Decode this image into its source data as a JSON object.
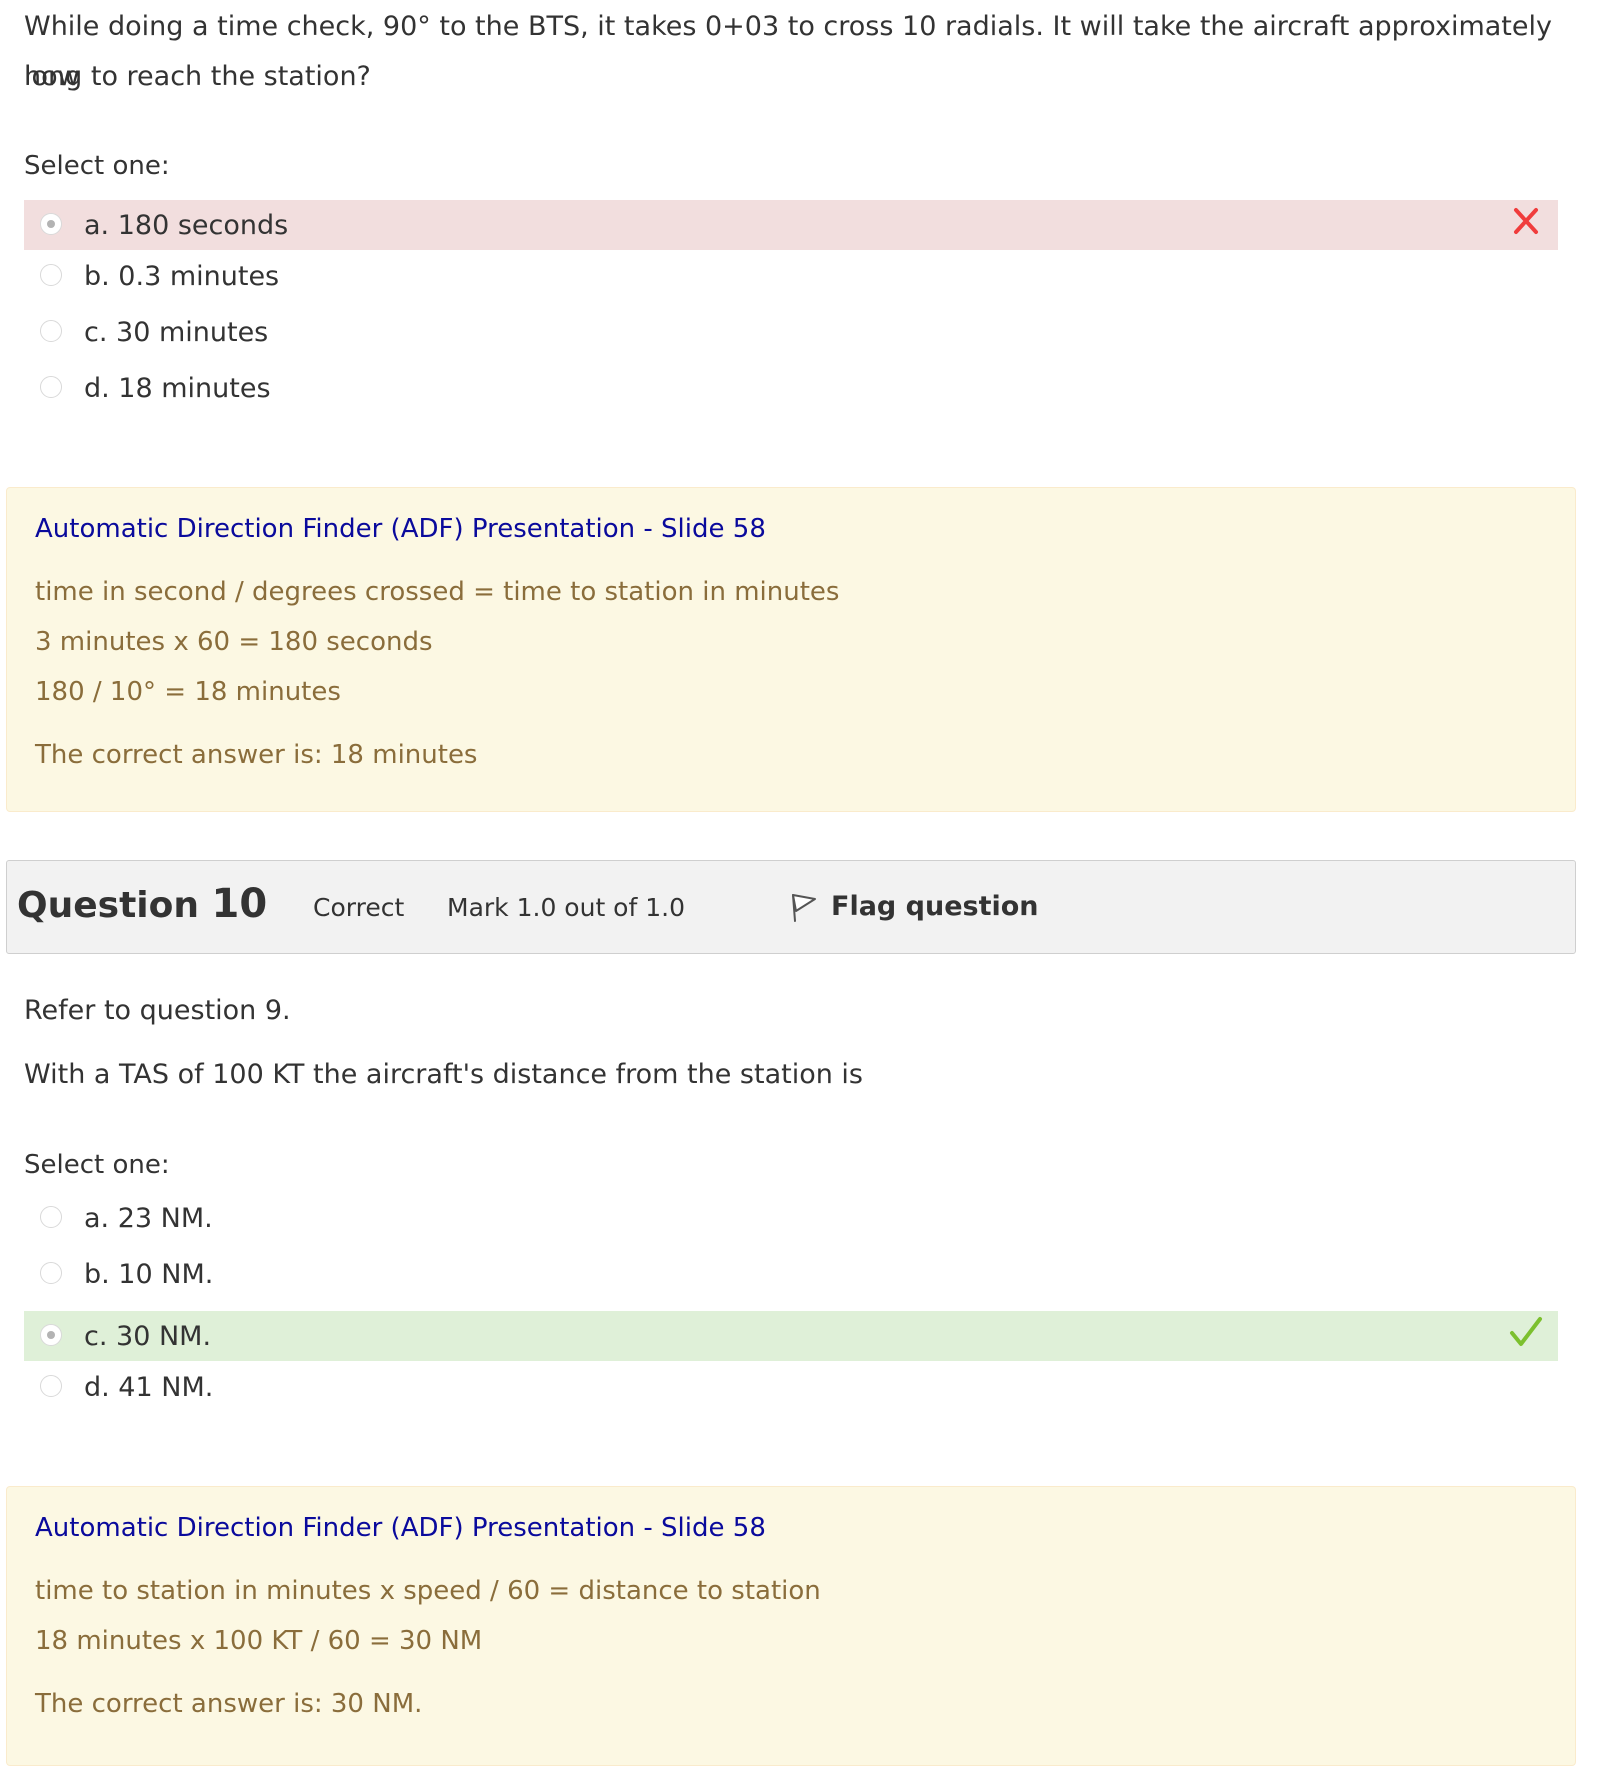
{
  "question9": {
    "text_line1": "While doing a time check, 90° to the BTS, it takes 0+03 to cross 10 radials. It will take the aircraft approximately how",
    "text_line2": "long to reach the station?",
    "prompt": "Select one:",
    "answers": [
      {
        "label": "a. 180 seconds",
        "checked": true,
        "state": "incorrect"
      },
      {
        "label": "b. 0.3 minutes",
        "checked": false,
        "state": ""
      },
      {
        "label": "c. 30 minutes",
        "checked": false,
        "state": ""
      },
      {
        "label": "d. 18 minutes",
        "checked": false,
        "state": ""
      }
    ],
    "feedback": {
      "link": "Automatic Direction Finder (ADF) Presentation - Slide 58",
      "lines": [
        "time in second / degrees crossed = time to station in minutes",
        "3 minutes x 60 = 180 seconds",
        "180 / 10° = 18 minutes"
      ],
      "right_answer": "The correct answer is: 18 minutes"
    }
  },
  "question10": {
    "header": {
      "title_prefix": "Question",
      "number": "10",
      "state": "Correct",
      "grade": "Mark 1.0 out of 1.0",
      "flag_label": "Flag question"
    },
    "text_line1": "Refer to question 9.",
    "text_line2": "With a TAS of 100 KT the aircraft's distance from the station is",
    "prompt": "Select one:",
    "answers": [
      {
        "label": "a. 23 NM.",
        "checked": false,
        "state": ""
      },
      {
        "label": "b. 10 NM.",
        "checked": false,
        "state": ""
      },
      {
        "label": "c. 30 NM.",
        "checked": true,
        "state": "correct"
      },
      {
        "label": "d. 41 NM.",
        "checked": false,
        "state": ""
      }
    ],
    "feedback": {
      "link": "Automatic Direction Finder (ADF) Presentation - Slide 58",
      "lines": [
        "time to station in minutes x speed / 60 = distance to station",
        "18 minutes x 100 KT / 60 = 30 NM"
      ],
      "right_answer": "The correct answer is: 30 NM."
    }
  },
  "colors": {
    "incorrect_bg": "#f2dede",
    "correct_bg": "#dff0d8",
    "feedback_bg": "#fcf8e3",
    "feedback_text": "#8a6d3b",
    "link": "#0a0a9c",
    "incorrect_icon": "#f03c3c",
    "correct_icon": "#7cc02e"
  },
  "icons": {
    "incorrect": "cross-icon",
    "correct": "check-icon",
    "flag": "flag-icon"
  }
}
